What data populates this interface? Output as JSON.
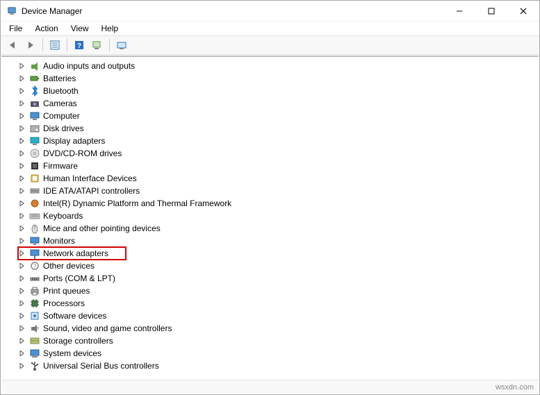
{
  "window": {
    "title": "Device Manager"
  },
  "menu": {
    "file": "File",
    "action": "Action",
    "view": "View",
    "help": "Help"
  },
  "toolbar": {
    "back_icon": "back-icon",
    "forward_icon": "forward-icon",
    "properties_icon": "properties-icon",
    "help_icon": "help-icon",
    "scan_icon": "scan-icon",
    "show_hidden_icon": "show-hidden-icon"
  },
  "tree": {
    "items": [
      {
        "label": "Audio inputs and outputs",
        "icon": "audio-icon"
      },
      {
        "label": "Batteries",
        "icon": "battery-icon"
      },
      {
        "label": "Bluetooth",
        "icon": "bluetooth-icon"
      },
      {
        "label": "Cameras",
        "icon": "camera-icon"
      },
      {
        "label": "Computer",
        "icon": "computer-icon"
      },
      {
        "label": "Disk drives",
        "icon": "disk-icon"
      },
      {
        "label": "Display adapters",
        "icon": "display-icon"
      },
      {
        "label": "DVD/CD-ROM drives",
        "icon": "cd-icon"
      },
      {
        "label": "Firmware",
        "icon": "firmware-icon"
      },
      {
        "label": "Human Interface Devices",
        "icon": "hid-icon"
      },
      {
        "label": "IDE ATA/ATAPI controllers",
        "icon": "ide-icon"
      },
      {
        "label": "Intel(R) Dynamic Platform and Thermal Framework",
        "icon": "intel-icon"
      },
      {
        "label": "Keyboards",
        "icon": "keyboard-icon"
      },
      {
        "label": "Mice and other pointing devices",
        "icon": "mouse-icon"
      },
      {
        "label": "Monitors",
        "icon": "monitor-icon"
      },
      {
        "label": "Network adapters",
        "icon": "network-icon",
        "highlighted": true
      },
      {
        "label": "Other devices",
        "icon": "other-icon"
      },
      {
        "label": "Ports (COM & LPT)",
        "icon": "port-icon"
      },
      {
        "label": "Print queues",
        "icon": "printer-icon"
      },
      {
        "label": "Processors",
        "icon": "cpu-icon"
      },
      {
        "label": "Software devices",
        "icon": "software-icon"
      },
      {
        "label": "Sound, video and game controllers",
        "icon": "sound-icon"
      },
      {
        "label": "Storage controllers",
        "icon": "storage-icon"
      },
      {
        "label": "System devices",
        "icon": "system-icon"
      },
      {
        "label": "Universal Serial Bus controllers",
        "icon": "usb-icon"
      }
    ]
  },
  "watermark": "wsxdn.com"
}
